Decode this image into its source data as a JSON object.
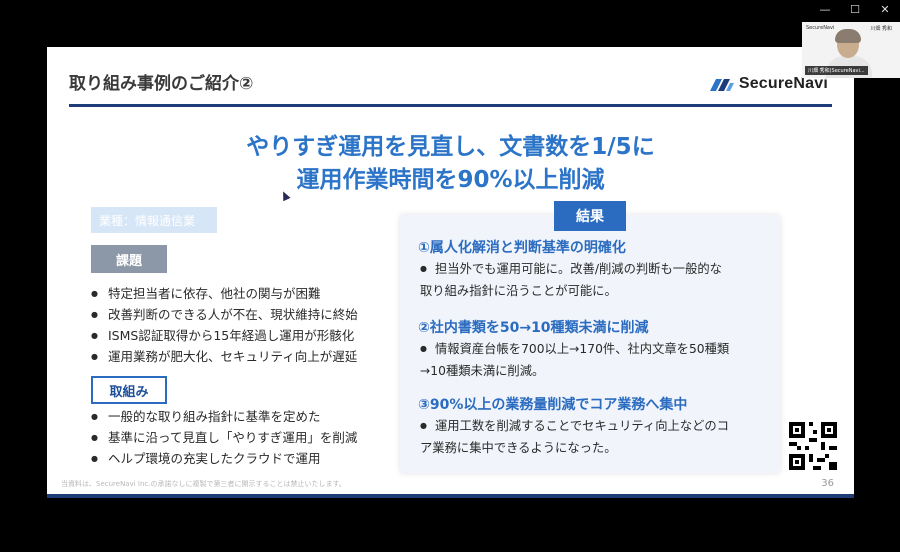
{
  "window": {
    "controls": [
      "—",
      "☐",
      "✕"
    ]
  },
  "slide": {
    "title": "取り組み事例のご紹介②",
    "logo_text": "SecureNavi",
    "headline_line1": "やりすぎ運用を見直し、文書数を1/5に",
    "headline_line2": "運用作業時間を90%以上削減",
    "industry_badge": "業種：情報通信業",
    "issues": {
      "label": "課題",
      "items": [
        "特定担当者に依存、他社の関与が困難",
        "改善判断のできる人が不在、現状維持に終始",
        "ISMS認証取得から15年経過し運用が形骸化",
        "運用業務が肥大化、セキュリティ向上が遅延"
      ]
    },
    "actions": {
      "label": "取組み",
      "items": [
        "一般的な取り組み指針に基準を定めた",
        "基準に沿って見直し「やりすぎ運用」を削減",
        "ヘルプ環境の充実したクラウドで運用"
      ]
    },
    "results": {
      "label": "結果",
      "items": [
        {
          "heading": "①属人化解消と判断基準の明確化",
          "line1": "担当外でも運用可能に。改善/削減の判断も一般的な",
          "line2": "取り組み指針に沿うことが可能に。"
        },
        {
          "heading": "②社内書類を50→10種類未満に削減",
          "line1": "情報資産台帳を700以上→170件、社内文章を50種類",
          "line2": "→10種類未満に削減。"
        },
        {
          "heading": "③90%以上の業務量削減でコア業務へ集中",
          "line1": "運用工数を削減することでセキュリティ向上などのコ",
          "line2": "ア業務に集中できるようになった。"
        }
      ]
    },
    "footer_note": "当資料は、SecureNavi Inc.の承諾なしに複製で第三者に開示することは禁止いたします。",
    "page_number": "36"
  },
  "video": {
    "logo": "SecureNavi",
    "name_top": "川畑 秀和",
    "label": "川畑 秀和(SecureNavi..."
  },
  "colors": {
    "accent": "#2b6cc0",
    "navy": "#1e3c78",
    "headline": "#2b74c8"
  }
}
